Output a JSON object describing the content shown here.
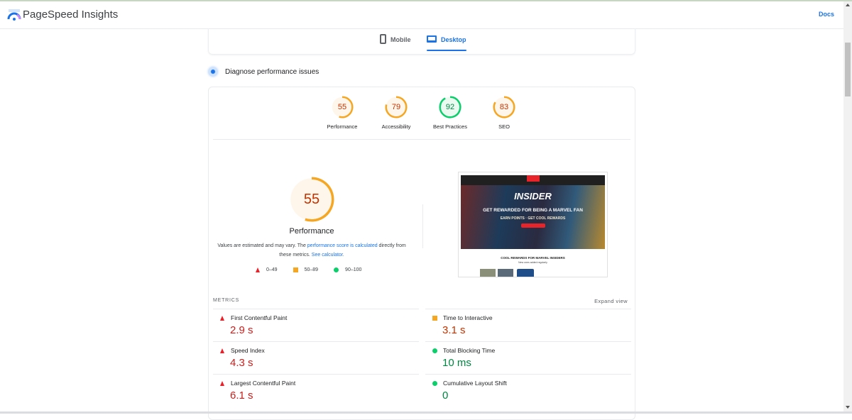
{
  "header": {
    "brand": "PageSpeed Insights",
    "docs_link": "Docs"
  },
  "tabs": [
    {
      "label": "Mobile",
      "icon": "phone-icon",
      "active": false
    },
    {
      "label": "Desktop",
      "icon": "laptop-icon",
      "active": true
    }
  ],
  "section_title": "Diagnose performance issues",
  "categories": [
    {
      "label": "Performance",
      "score": 55,
      "color": "#f5a623",
      "text_color": "#c33300"
    },
    {
      "label": "Accessibility",
      "score": 79,
      "color": "#f5a623",
      "text_color": "#c33300"
    },
    {
      "label": "Best Practices",
      "score": 92,
      "color": "#0cce6b",
      "text_color": "#018642"
    },
    {
      "label": "SEO",
      "score": 83,
      "color": "#f5a623",
      "text_color": "#c33300"
    }
  ],
  "performance": {
    "score": 55,
    "title": "Performance",
    "desc_prefix": "Values are estimated and may vary. The ",
    "desc_link1": "performance score is calculated",
    "desc_middle": " directly from these metrics. ",
    "desc_link2": "See calculator.",
    "legend": [
      {
        "shape": "triangle",
        "range": "0–49",
        "color": "#e8212a"
      },
      {
        "shape": "square",
        "range": "50–89",
        "color": "#f5a623"
      },
      {
        "shape": "circle",
        "range": "90–100",
        "color": "#0cce6b"
      }
    ]
  },
  "screenshot": {
    "headline": "INSIDER",
    "tagline": "GET REWARDED FOR BEING A MARVEL FAN",
    "subline": "EARN POINTS · GET COOL REWARDS",
    "section": "COOL REWARDS FOR MARVEL INSIDERS",
    "section_sub": "New ones added regularly"
  },
  "metrics": {
    "header": "METRICS",
    "expand_label": "Expand view",
    "left": [
      {
        "name": "First Contentful Paint",
        "value": "2.9 s",
        "rating": "poor"
      },
      {
        "name": "Speed Index",
        "value": "4.3 s",
        "rating": "poor"
      },
      {
        "name": "Largest Contentful Paint",
        "value": "6.1 s",
        "rating": "poor"
      }
    ],
    "right": [
      {
        "name": "Time to Interactive",
        "value": "3.1 s",
        "rating": "average"
      },
      {
        "name": "Total Blocking Time",
        "value": "10 ms",
        "rating": "good"
      },
      {
        "name": "Cumulative Layout Shift",
        "value": "0",
        "rating": "good"
      }
    ]
  }
}
